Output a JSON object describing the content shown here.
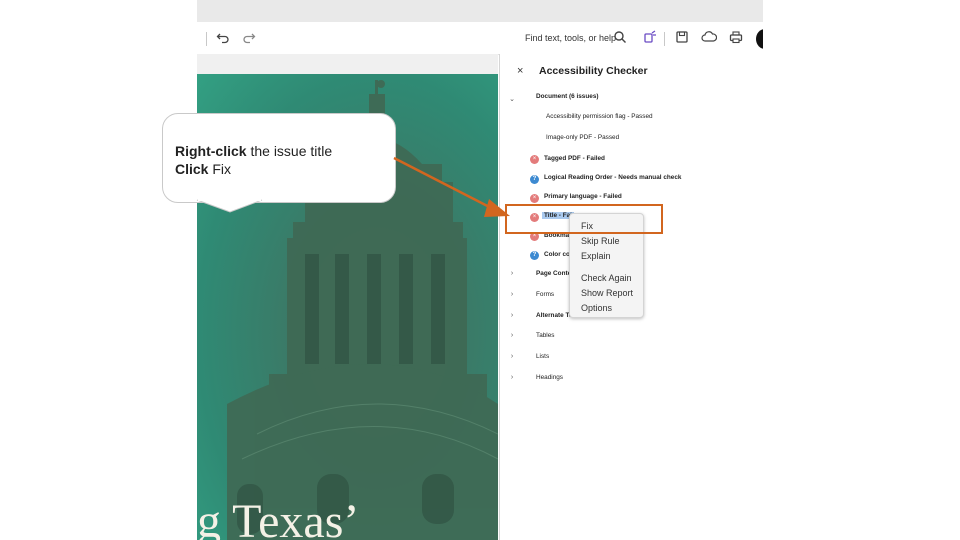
{
  "toolbar": {
    "find_text": "Find text, tools, or help",
    "icons": [
      "undo-icon",
      "redo-icon",
      "search-icon",
      "edit-magic-icon",
      "save-icon",
      "cloud-icon",
      "print-icon"
    ]
  },
  "document": {
    "title_fragment": "g Texas’"
  },
  "panel": {
    "title": "Accessibility Checker",
    "close": "×",
    "items": [
      {
        "label": "Document (6 issues)",
        "type": "group-expanded"
      },
      {
        "label": "Accessibility permission flag - Passed",
        "type": "passed"
      },
      {
        "label": "Image-only PDF - Passed",
        "type": "passed"
      },
      {
        "label": "Tagged PDF - Failed",
        "type": "failed"
      },
      {
        "label": "Logical Reading Order - Needs manual check",
        "type": "manual"
      },
      {
        "label": "Primary language - Failed",
        "type": "failed"
      },
      {
        "label": "Title - Failed",
        "type": "failed-selected",
        "visible": "Title - Fai"
      },
      {
        "label": "Bookmarks - Failed",
        "type": "failed",
        "visible": "Bookma"
      },
      {
        "label": "Color contrast - Needs manual check",
        "type": "manual",
        "visible_start": "Color cor",
        "visible_end": "eck"
      },
      {
        "label": "Page Content",
        "type": "group",
        "visible": "Page Conte"
      },
      {
        "label": "Forms",
        "type": "group"
      },
      {
        "label": "Alternate Text",
        "type": "group",
        "visible": "Alternate Te"
      },
      {
        "label": "Tables",
        "type": "group"
      },
      {
        "label": "Lists",
        "type": "group"
      },
      {
        "label": "Headings",
        "type": "group"
      }
    ]
  },
  "context_menu": {
    "items": [
      "Fix",
      "Skip Rule",
      "Explain",
      "Check Again",
      "Show Report",
      "Options"
    ]
  },
  "callout": {
    "line1_bold": "Right-click",
    "line1_rest": " the issue title",
    "line2_bold": "Click",
    "line2_rest": " Fix"
  },
  "colors": {
    "accent_orange": "#d2661f",
    "fail_red": "#e37b7b",
    "help_blue": "#3d8ad1",
    "selection": "#a9c9ee"
  }
}
